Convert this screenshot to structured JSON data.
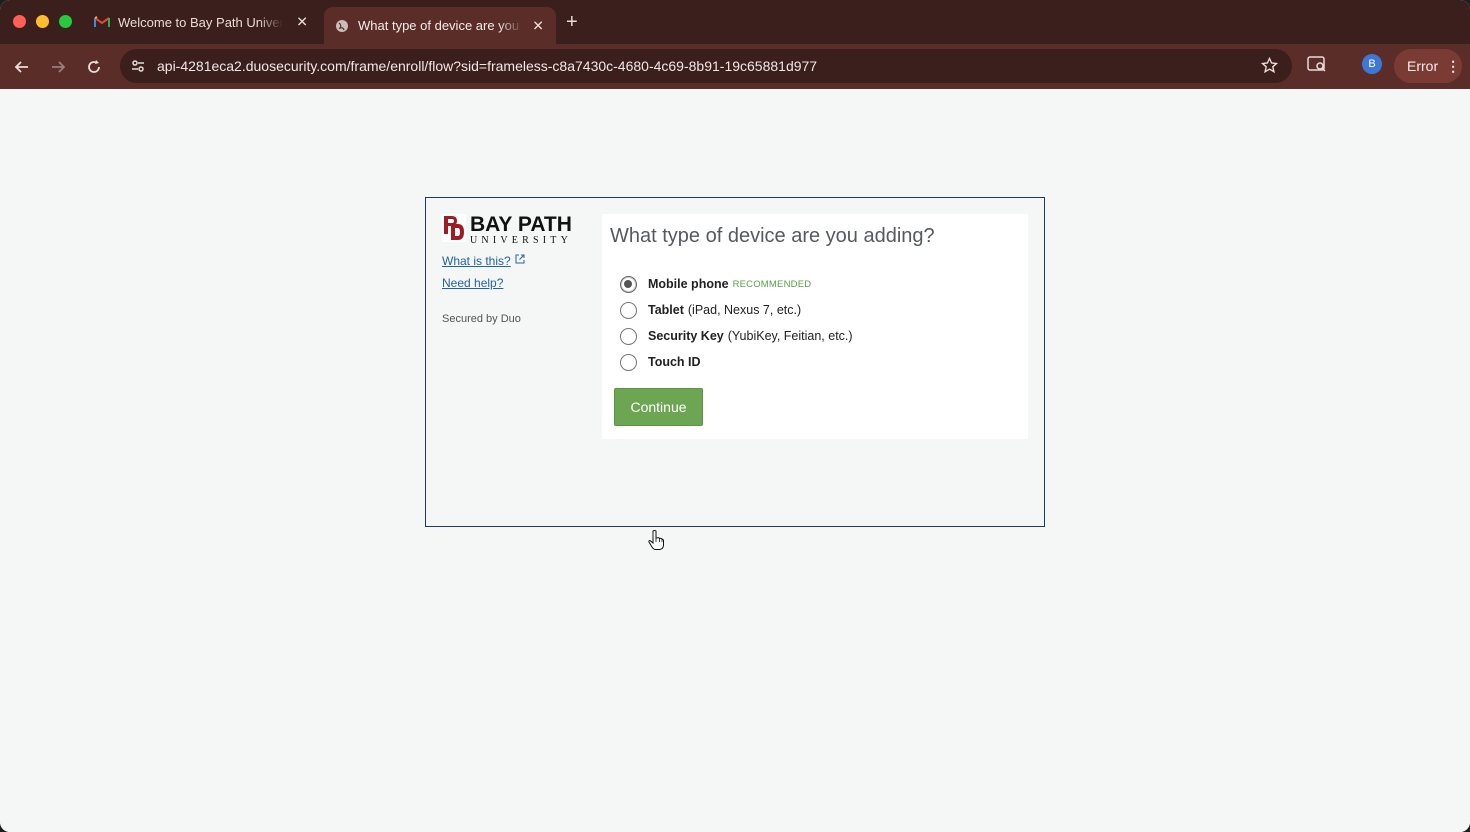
{
  "browser": {
    "tabs": [
      {
        "title": "Welcome to Bay Path University",
        "favicon": "gmail-icon",
        "active": false
      },
      {
        "title": "What type of device are you adding?",
        "favicon": "globe-icon",
        "active": true
      }
    ],
    "url": "api-4281eca2.duosecurity.com/frame/enroll/flow?sid=frameless-c8a7430c-4680-4c69-8b91-19c65881d977",
    "profile_initial": "B",
    "error_label": "Error"
  },
  "sidebar": {
    "logo_main": "BAY PATH",
    "logo_sub": "UNIVERSITY",
    "what_is_this": "What is this?",
    "need_help": "Need help?",
    "secured_by": "Secured by Duo"
  },
  "enroll": {
    "question": "What type of device are you adding?",
    "options": [
      {
        "name": "Mobile phone",
        "detail": "",
        "badge": "RECOMMENDED",
        "selected": true
      },
      {
        "name": "Tablet",
        "detail": "(iPad, Nexus 7, etc.)",
        "badge": "",
        "selected": false
      },
      {
        "name": "Security Key",
        "detail": "(YubiKey, Feitian, etc.)",
        "badge": "",
        "selected": false
      },
      {
        "name": "Touch ID",
        "detail": "",
        "badge": "",
        "selected": false
      }
    ],
    "continue_label": "Continue"
  },
  "colors": {
    "chrome_dark": "#3b1f1c",
    "chrome_toolbar": "#5a2d28",
    "continue_green": "#6da652",
    "link_blue": "#2162a8",
    "recommended_green": "#56a24a"
  }
}
